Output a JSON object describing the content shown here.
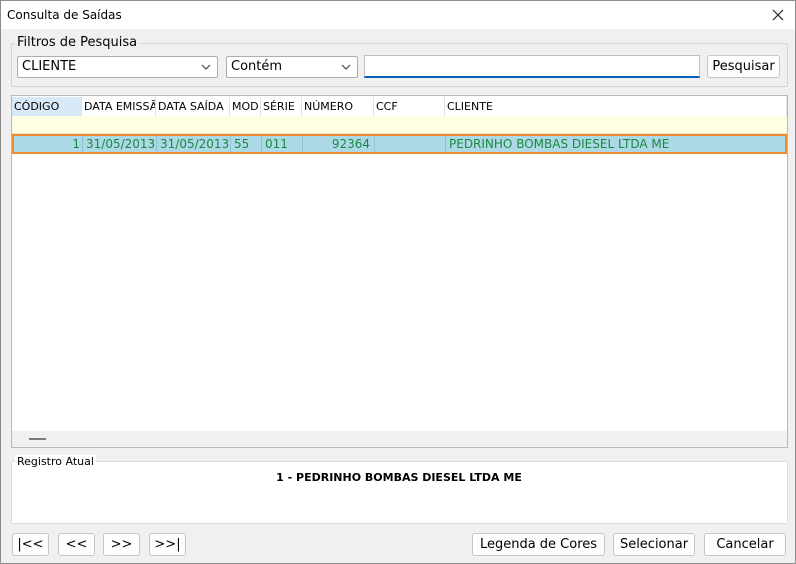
{
  "window": {
    "title": "Consulta de Saídas"
  },
  "filters": {
    "legend": "Filtros de Pesquisa",
    "field_value": "CLIENTE",
    "operator_value": "Contém",
    "search_value": "",
    "search_label": "Pesquisar"
  },
  "grid": {
    "columns": [
      "CÓDIGO",
      "DATA EMISSÃO",
      "DATA SAÍDA",
      "MOD",
      "SÉRIE",
      "NÚMERO",
      "CCF",
      "CLIENTE"
    ],
    "rows": [
      {
        "codigo": "1",
        "data_emissao": "31/05/2013",
        "data_saida": "31/05/2013",
        "mod": "55",
        "serie": "011",
        "numero": "92364",
        "ccf": "",
        "cliente": "PEDRINHO BOMBAS DIESEL LTDA ME"
      }
    ]
  },
  "current_record": {
    "legend": "Registro Atual",
    "text": "1 - PEDRINHO BOMBAS DIESEL LTDA ME"
  },
  "navigation": {
    "first": "|<<",
    "prev": "<<",
    "next": ">>",
    "last": ">>|"
  },
  "actions": {
    "legend_colors": "Legenda de Cores",
    "select": "Selecionar",
    "cancel": "Cancelar"
  },
  "colors": {
    "accent": "#005fb8",
    "row_selected": "#add8e6",
    "row_border": "#f08c30",
    "row_text": "#1a8a40",
    "filter_row": "#fefee3"
  }
}
